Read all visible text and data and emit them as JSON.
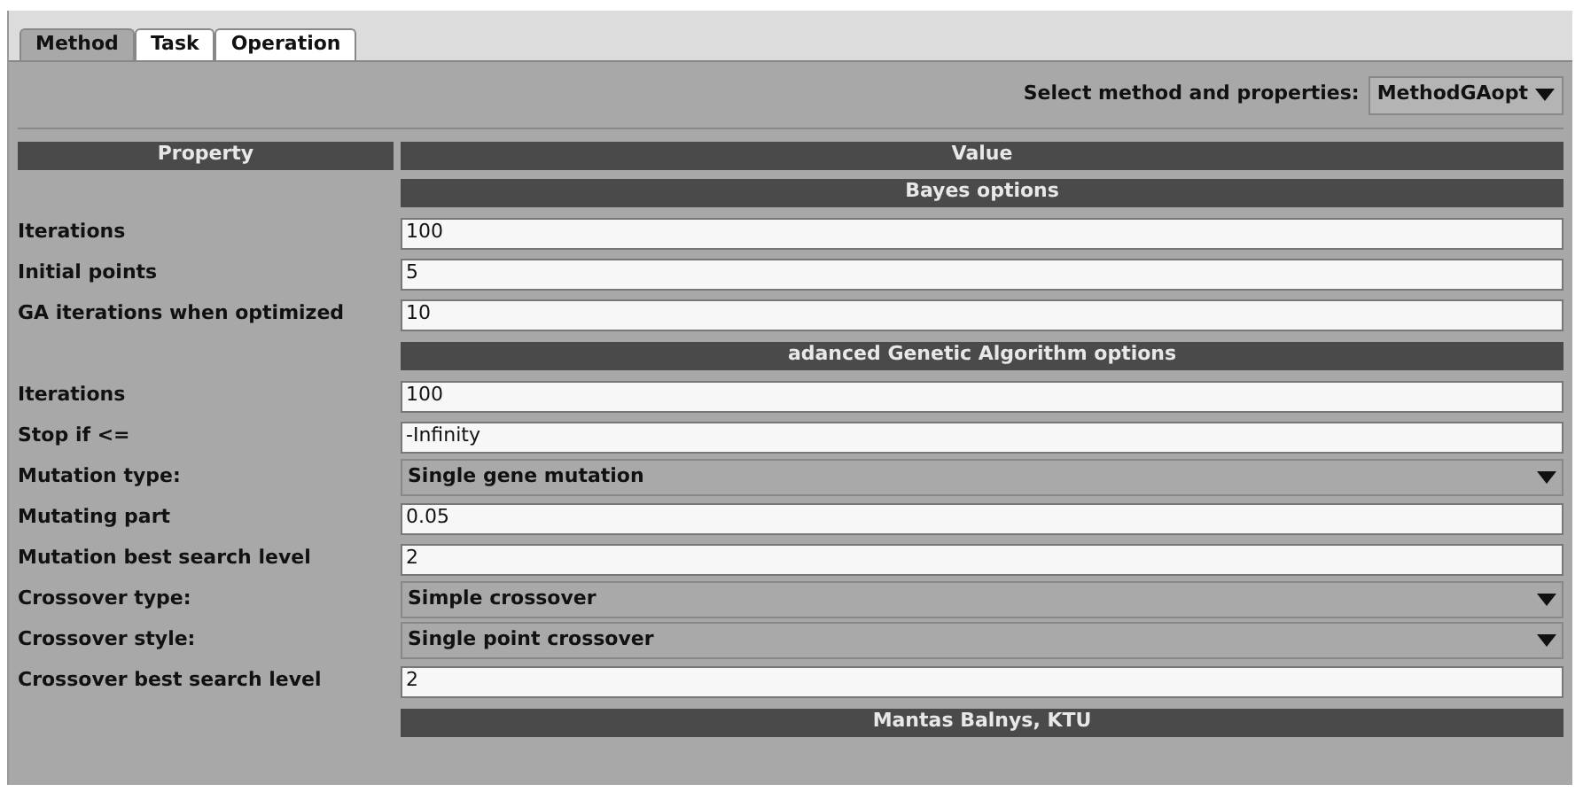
{
  "tabs": [
    {
      "label": "Method",
      "selected": true
    },
    {
      "label": "Task",
      "selected": false
    },
    {
      "label": "Operation",
      "selected": false
    }
  ],
  "method_selector": {
    "label": "Select method and properties:",
    "value": "MethodGAopt"
  },
  "table": {
    "columns": [
      "Property",
      "Value"
    ],
    "rows": [
      {
        "kind": "section",
        "title": "Bayes options"
      },
      {
        "kind": "text",
        "property": "Iterations",
        "value": "100"
      },
      {
        "kind": "text",
        "property": "Initial points",
        "value": "5"
      },
      {
        "kind": "text",
        "property": "GA iterations when optimized",
        "value": "10"
      },
      {
        "kind": "section",
        "title": "adanced Genetic Algorithm options"
      },
      {
        "kind": "text",
        "property": "Iterations",
        "value": "100"
      },
      {
        "kind": "text",
        "property": "Stop if <=",
        "value": "-Infinity"
      },
      {
        "kind": "dropdown",
        "property": "Mutation type:",
        "value": "Single gene mutation"
      },
      {
        "kind": "text",
        "property": "Mutating part",
        "value": "0.05"
      },
      {
        "kind": "text",
        "property": "Mutation best search level",
        "value": "2"
      },
      {
        "kind": "dropdown",
        "property": "Crossover type:",
        "value": "Simple crossover"
      },
      {
        "kind": "dropdown",
        "property": "Crossover style:",
        "value": "Single point crossover"
      },
      {
        "kind": "text",
        "property": "Crossover best search level",
        "value": "2"
      },
      {
        "kind": "section",
        "title": "Mantas Balnys, KTU"
      }
    ]
  }
}
